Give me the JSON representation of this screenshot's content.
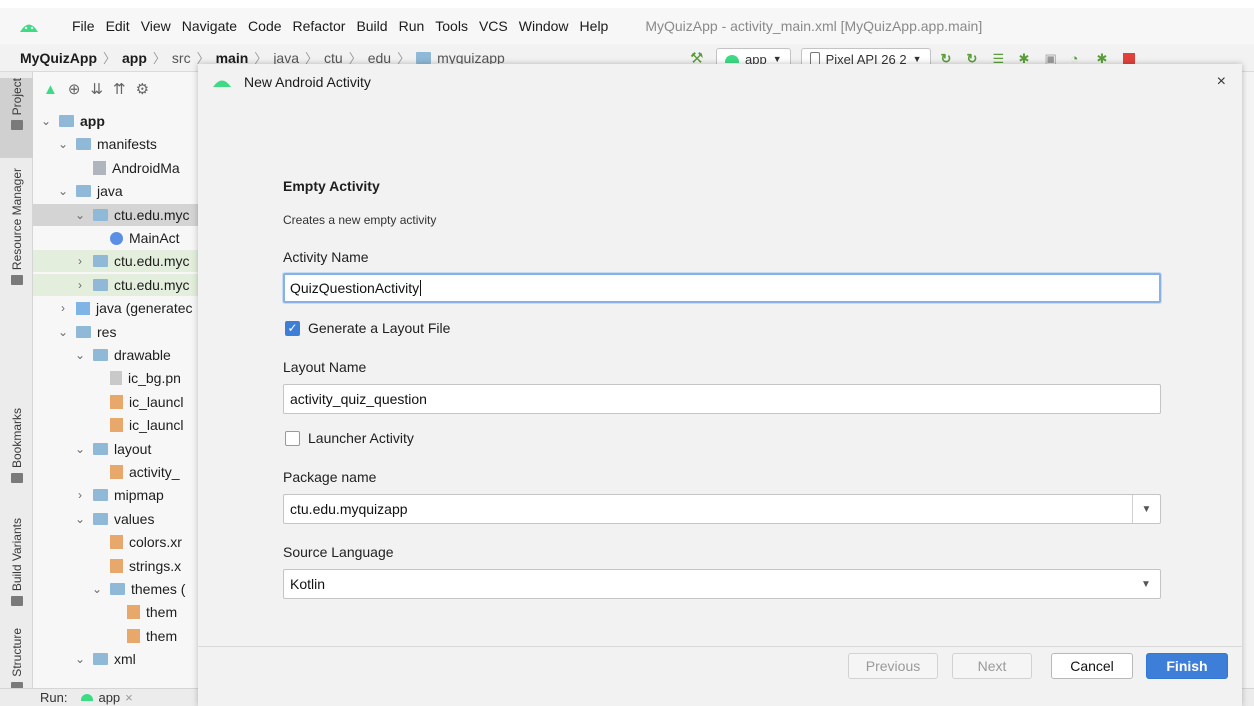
{
  "menu": {
    "items": [
      "File",
      "Edit",
      "View",
      "Navigate",
      "Code",
      "Refactor",
      "Build",
      "Run",
      "Tools",
      "VCS",
      "Window",
      "Help"
    ],
    "window_title": "MyQuizApp - activity_main.xml [MyQuizApp.app.main]"
  },
  "breadcrumb": [
    "MyQuizApp",
    "app",
    "src",
    "main",
    "java",
    "ctu",
    "edu",
    "myquizapp"
  ],
  "toolbar": {
    "run_config": "app",
    "device": "Pixel API 26 2"
  },
  "tool_strip": [
    "Project",
    "Resource Manager",
    "Bookmarks",
    "Build Variants",
    "Structure"
  ],
  "project_tree": [
    {
      "label": "app",
      "chevron": "down",
      "icon": "folder-app",
      "depth": 0,
      "bold": true,
      "state": ""
    },
    {
      "label": "manifests",
      "chevron": "down",
      "icon": "folder",
      "depth": 1,
      "state": ""
    },
    {
      "label": "AndroidMa",
      "chevron": "",
      "icon": "file-mf",
      "depth": 2,
      "state": ""
    },
    {
      "label": "java",
      "chevron": "down",
      "icon": "folder",
      "depth": 1,
      "state": ""
    },
    {
      "label": "ctu.edu.myc",
      "chevron": "down",
      "icon": "folder",
      "depth": 2,
      "state": "sel"
    },
    {
      "label": "MainAct",
      "chevron": "",
      "icon": "file-kt",
      "depth": 3,
      "state": ""
    },
    {
      "label": "ctu.edu.myc",
      "chevron": "right",
      "icon": "folder",
      "depth": 2,
      "state": "hl"
    },
    {
      "label": "ctu.edu.myc",
      "chevron": "right",
      "icon": "folder",
      "depth": 2,
      "state": "hl"
    },
    {
      "label": "java (generatec",
      "chevron": "right",
      "icon": "file-gen",
      "depth": 1,
      "state": ""
    },
    {
      "label": "res",
      "chevron": "down",
      "icon": "folder",
      "depth": 1,
      "state": ""
    },
    {
      "label": "drawable",
      "chevron": "down",
      "icon": "folder",
      "depth": 2,
      "state": ""
    },
    {
      "label": "ic_bg.pn",
      "chevron": "",
      "icon": "file-png",
      "depth": 3,
      "state": ""
    },
    {
      "label": "ic_launcl",
      "chevron": "",
      "icon": "file-xml",
      "depth": 3,
      "state": ""
    },
    {
      "label": "ic_launcl",
      "chevron": "",
      "icon": "file-xml",
      "depth": 3,
      "state": ""
    },
    {
      "label": "layout",
      "chevron": "down",
      "icon": "folder",
      "depth": 2,
      "state": ""
    },
    {
      "label": "activity_",
      "chevron": "",
      "icon": "file-xml",
      "depth": 3,
      "state": ""
    },
    {
      "label": "mipmap",
      "chevron": "right",
      "icon": "folder",
      "depth": 2,
      "state": ""
    },
    {
      "label": "values",
      "chevron": "down",
      "icon": "folder",
      "depth": 2,
      "state": ""
    },
    {
      "label": "colors.xr",
      "chevron": "",
      "icon": "file-xml",
      "depth": 3,
      "state": ""
    },
    {
      "label": "strings.x",
      "chevron": "",
      "icon": "file-xml",
      "depth": 3,
      "state": ""
    },
    {
      "label": "themes (",
      "chevron": "down",
      "icon": "folder",
      "depth": 3,
      "state": ""
    },
    {
      "label": "them",
      "chevron": "",
      "icon": "file-xml",
      "depth": 4,
      "state": ""
    },
    {
      "label": "them",
      "chevron": "",
      "icon": "file-xml",
      "depth": 4,
      "state": ""
    },
    {
      "label": "xml",
      "chevron": "down",
      "icon": "folder",
      "depth": 2,
      "state": ""
    }
  ],
  "status_bar": {
    "run_label": "Run:",
    "run_tab": "app"
  },
  "dialog": {
    "title": "New Android Activity",
    "close_icon": "×",
    "section_title": "Empty Activity",
    "section_desc": "Creates a new empty activity",
    "activity_name_label": "Activity Name",
    "activity_name_value": "QuizQuestionActivity",
    "generate_layout_label": "Generate a Layout File",
    "generate_layout_checked": true,
    "layout_name_label": "Layout Name",
    "layout_name_value": "activity_quiz_question",
    "launcher_label": "Launcher Activity",
    "launcher_checked": false,
    "package_label": "Package name",
    "package_value": "ctu.edu.myquizapp",
    "source_language_label": "Source Language",
    "source_language_value": "Kotlin",
    "buttons": {
      "previous": "Previous",
      "next": "Next",
      "cancel": "Cancel",
      "finish": "Finish"
    }
  },
  "colors": {
    "accent": "#3d7fd8",
    "android_green": "#3ddc84",
    "selection": "#d4d4d4",
    "highlight_row": "#e3efdc"
  }
}
